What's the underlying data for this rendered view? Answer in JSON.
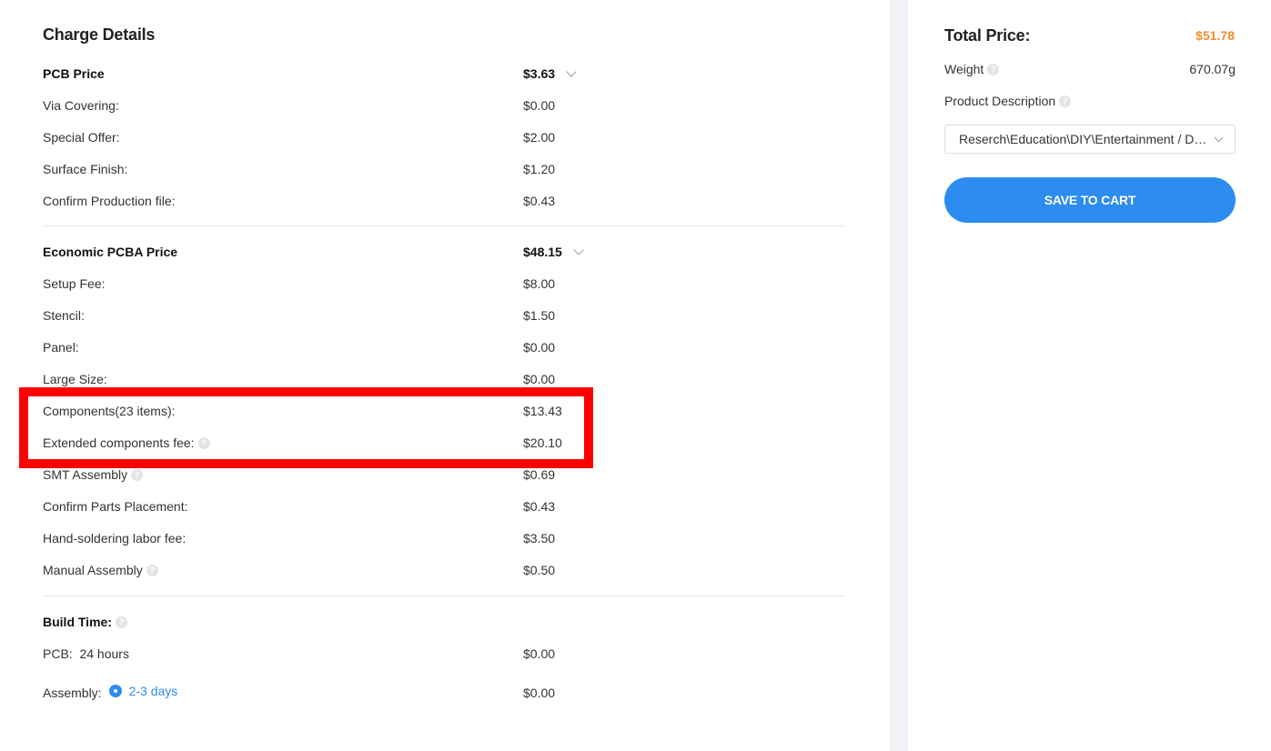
{
  "charge_details": {
    "title": "Charge Details",
    "pcb": {
      "label": "PCB Price",
      "value": "$3.63",
      "items": [
        {
          "label": "Via Covering:",
          "value": "$0.00"
        },
        {
          "label": "Special Offer:",
          "value": "$2.00"
        },
        {
          "label": "Surface Finish:",
          "value": "$1.20"
        },
        {
          "label": "Confirm Production file:",
          "value": "$0.43"
        }
      ]
    },
    "pcba": {
      "label": "Economic PCBA Price",
      "value": "$48.15",
      "items": [
        {
          "label": "Setup Fee:",
          "value": "$8.00"
        },
        {
          "label": "Stencil:",
          "value": "$1.50"
        },
        {
          "label": "Panel:",
          "value": "$0.00"
        },
        {
          "label": "Large Size:",
          "value": "$0.00"
        },
        {
          "label": "Components(23 items):",
          "value": "$13.43"
        },
        {
          "label": "Extended components fee:",
          "value": "$20.10"
        },
        {
          "label": "SMT Assembly",
          "value": "$0.69"
        },
        {
          "label": "Confirm Parts Placement:",
          "value": "$0.43"
        },
        {
          "label": "Hand-soldering labor fee:",
          "value": "$3.50"
        },
        {
          "label": "Manual Assembly",
          "value": "$0.50"
        }
      ]
    },
    "build_time": {
      "label": "Build Time:",
      "pcb_label": "PCB:  24 hours",
      "pcb_value": "$0.00",
      "assembly_label": "Assembly:",
      "assembly_option": "2-3 days",
      "assembly_value": "$0.00"
    }
  },
  "summary": {
    "total_label": "Total Price:",
    "total_value": "$51.78",
    "weight_label": "Weight",
    "weight_value": "670.07g",
    "description_label": "Product Description",
    "description_value": "Reserch\\Education\\DIY\\Entertainment / DIY Kit",
    "save_button": "SAVE TO CART"
  },
  "colors": {
    "accent": "#2d8cf0",
    "total_price": "#f98b2c",
    "highlight": "#ff0000"
  }
}
